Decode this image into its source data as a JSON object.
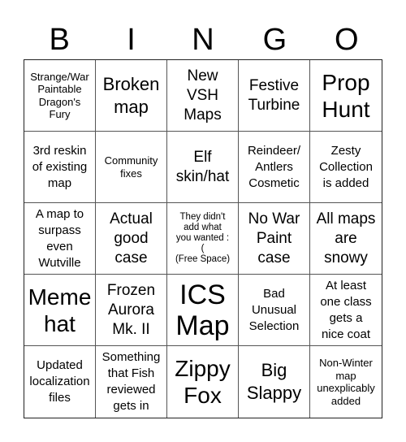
{
  "header": {
    "letters": [
      "B",
      "I",
      "N",
      "G",
      "O"
    ]
  },
  "cells": [
    {
      "text": "Strange/War\nPaintable\nDragon's\nFury"
    },
    {
      "text": "Broken\nmap"
    },
    {
      "text": "New\nVSH\nMaps"
    },
    {
      "text": "Festive\nTurbine"
    },
    {
      "text": "Prop\nHunt"
    },
    {
      "text": "3rd reskin\nof existing\nmap"
    },
    {
      "text": "Community\nfixes"
    },
    {
      "text": "Elf\nskin/hat"
    },
    {
      "text": "Reindeer/\nAntlers\nCosmetic"
    },
    {
      "text": "Zesty\nCollection\nis added"
    },
    {
      "text": "A map to\nsurpass\neven\nWutville"
    },
    {
      "text": "Actual\ngood\ncase"
    },
    {
      "text": "They didn't\nadd what\nyou wanted :\n(\n(Free Space)"
    },
    {
      "text": "No War\nPaint\ncase"
    },
    {
      "text": "All maps\nare\nsnowy"
    },
    {
      "text": "Meme\nhat"
    },
    {
      "text": "Frozen\nAurora\nMk. II"
    },
    {
      "text": "ICS\nMap"
    },
    {
      "text": "Bad\nUnusual\nSelection"
    },
    {
      "text": "At least\none class\ngets a\nnice coat"
    },
    {
      "text": "Updated\nlocalization\nfiles"
    },
    {
      "text": "Something\nthat Fish\nreviewed\ngets in"
    },
    {
      "text": "Zippy\nFox"
    },
    {
      "text": "Big\nSlappy"
    },
    {
      "text": "Non-Winter\nmap\nunexplicably\nadded"
    }
  ]
}
